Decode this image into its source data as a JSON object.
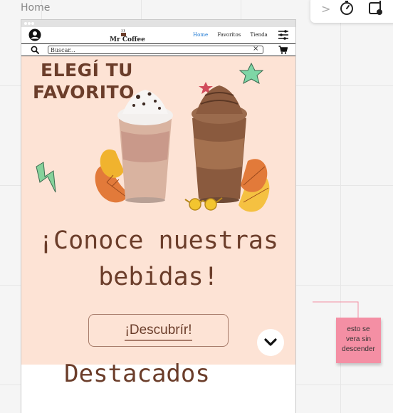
{
  "canvas": {
    "label": "Home"
  },
  "toolbar": {
    "chevron": ">"
  },
  "app": {
    "logo_text": "Mr Coffee",
    "nav": [
      {
        "label": "Home",
        "active": true
      },
      {
        "label": "Favoritos",
        "active": false
      },
      {
        "label": "Tienda",
        "active": false
      }
    ],
    "search": {
      "placeholder": "Buscar...",
      "clear": "×"
    }
  },
  "hero": {
    "promo_line1": "ELEGÍ TU",
    "promo_line2": "FAVORITO",
    "heading_line1": "¡Conoce nuestras",
    "heading_line2": "bebidas!",
    "cta_label": "¡Descubrír!"
  },
  "featured": {
    "title": "Destacados"
  },
  "sticky_note": {
    "text_line1": "esto se",
    "text_line2": "vera sin",
    "text_line3": "descender"
  },
  "colors": {
    "brand": "#6b3d2a",
    "hero_bg": "#fde3d5",
    "sticky": "#f48fa4",
    "active_link": "#1976d2"
  }
}
